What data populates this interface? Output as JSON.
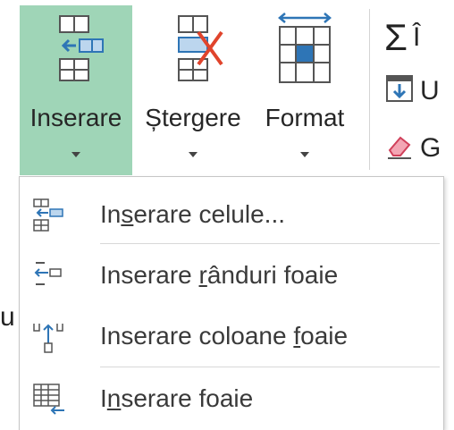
{
  "ribbon": {
    "buttons": [
      {
        "label": "Inserare",
        "active": true
      },
      {
        "label": "Ștergere",
        "active": false
      },
      {
        "label": "Format",
        "active": false
      }
    ],
    "right_items": [
      {
        "glyph": "Σ",
        "label": "Î"
      },
      {
        "glyph": "fill-down-icon",
        "label": "U"
      },
      {
        "glyph": "eraser-icon",
        "label": "G"
      }
    ]
  },
  "menu": {
    "items": [
      {
        "pre": "In",
        "ul": "s",
        "post": "erare celule..."
      },
      {
        "pre": "Inserare ",
        "ul": "r",
        "post": "ânduri foaie"
      },
      {
        "pre": "Inserare coloane ",
        "ul": "f",
        "post": "oaie"
      },
      {
        "pre": "I",
        "ul": "n",
        "post": "serare foaie"
      }
    ]
  },
  "stray_text": "u",
  "colors": {
    "active_bg": "#9fd5b7",
    "accent_blue": "#2e75b6",
    "delete_red": "#e0442c"
  }
}
